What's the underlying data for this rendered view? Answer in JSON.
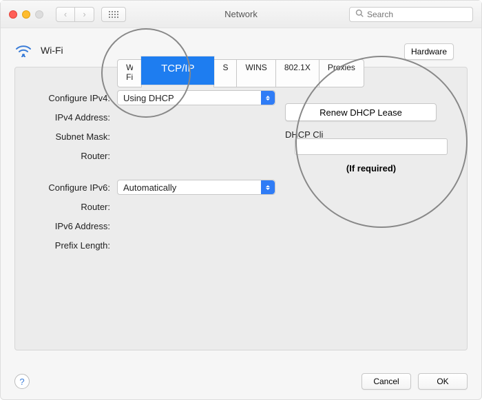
{
  "window": {
    "title": "Network"
  },
  "search": {
    "placeholder": "Search"
  },
  "wifi": {
    "label": "Wi-Fi"
  },
  "hardware_btn": "Hardware",
  "tabs": {
    "wifi": "Wi-Fi",
    "tcpip": "TCP/IP",
    "dns": "DNS",
    "wins": "WINS",
    "dot1x": "802.1X",
    "proxies": "Proxies"
  },
  "labels": {
    "configure_ipv4": "Configure IPv4:",
    "ipv4_address": "IPv4 Address:",
    "subnet_mask": "Subnet Mask:",
    "router": "Router:",
    "configure_ipv6": "Configure IPv6:",
    "router6": "Router:",
    "ipv6_address": "IPv6 Address:",
    "prefix_length": "Prefix Length:"
  },
  "values": {
    "ipv4_method": "Using DHCP",
    "ipv6_method": "Automatically"
  },
  "renew": {
    "label": "Renew DHCP Lease"
  },
  "dhcp_client": {
    "label": "DHCP Client ID:",
    "value": "",
    "note": "(If required)"
  },
  "buttons": {
    "cancel": "Cancel",
    "ok": "OK"
  }
}
